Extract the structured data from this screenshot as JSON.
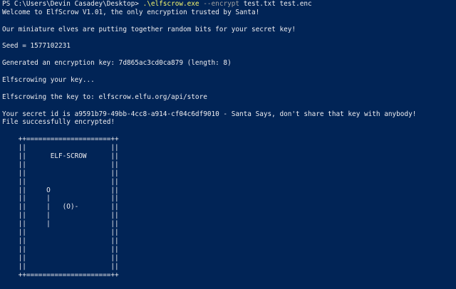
{
  "terminal": {
    "background": "#012456",
    "foreground": "#eeedf0",
    "command_color": "#f7f76e",
    "parameter_color": "#a0a0a0",
    "prompt": "PS C:\\Users\\Devin Casadey\\Desktop> ",
    "command": ".\\elfscrow.exe",
    "parameter": " --encrypt",
    "arguments": " test.txt test.enc",
    "output": [
      "Welcome to ElfScrow V1.01, the only encryption trusted by Santa!",
      "",
      "Our miniature elves are putting together random bits for your secret key!",
      "",
      "Seed = 1577102231",
      "",
      "Generated an encryption key: 7d865ac3cd0ca879 (length: 8)",
      "",
      "Elfscrowing your key...",
      "",
      "Elfscrowing the key to: elfscrow.elfu.org/api/store",
      "",
      "Your secret id is a9591b79-49bb-4cc8-a914-cf04c6df9010 - Santa Says, don't share that key with anybody!",
      "File successfully encrypted!",
      "",
      "    ++=====================++",
      "    ||                     ||",
      "    ||      ELF-SCROW      ||",
      "    ||                     ||",
      "    ||                     ||",
      "    ||                     ||",
      "    ||     O               ||",
      "    ||     |               ||",
      "    ||     |   (O)-        ||",
      "    ||     |               ||",
      "    ||     |               ||",
      "    ||                     ||",
      "    ||                     ||",
      "    ||                     ||",
      "    ||                     ||",
      "    ||                     ||",
      "    ++=====================++"
    ]
  }
}
